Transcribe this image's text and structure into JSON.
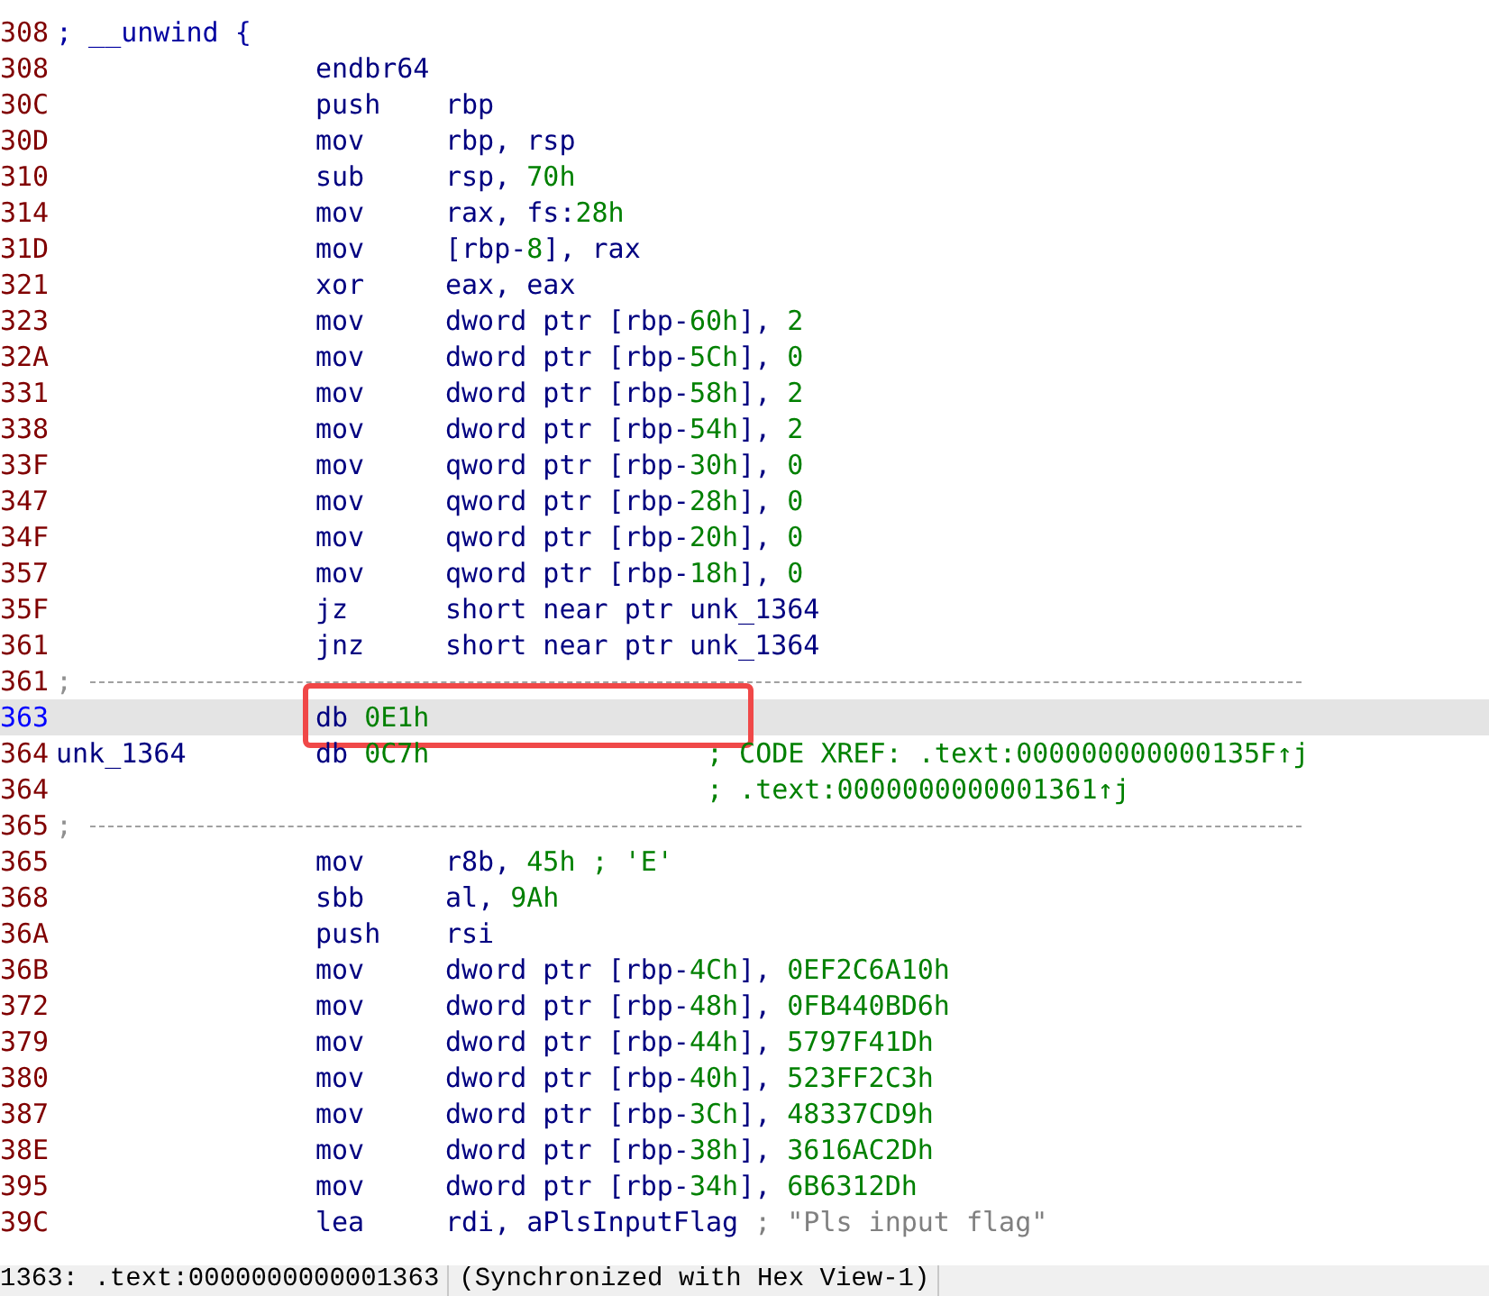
{
  "listing": [
    {
      "kind": "code",
      "addr": {
        "text": "308",
        "kind": "code"
      },
      "label": {
        "text": "; __unwind {",
        "kind": "comment"
      }
    },
    {
      "kind": "code",
      "addr": {
        "text": "308",
        "kind": "code"
      },
      "mnemonic": "endbr64"
    },
    {
      "kind": "code",
      "addr": {
        "text": "30C",
        "kind": "code"
      },
      "mnemonic": "push",
      "operands": [
        {
          "text": "rbp",
          "kind": "plain"
        }
      ]
    },
    {
      "kind": "code",
      "addr": {
        "text": "30D",
        "kind": "code"
      },
      "mnemonic": "mov",
      "operands": [
        {
          "text": "rbp, rsp",
          "kind": "plain"
        }
      ]
    },
    {
      "kind": "code",
      "addr": {
        "text": "310",
        "kind": "code"
      },
      "mnemonic": "sub",
      "operands": [
        {
          "text": "rsp, ",
          "kind": "plain"
        },
        {
          "text": "70h",
          "kind": "num"
        }
      ]
    },
    {
      "kind": "code",
      "addr": {
        "text": "314",
        "kind": "code"
      },
      "mnemonic": "mov",
      "operands": [
        {
          "text": "rax, fs:",
          "kind": "plain"
        },
        {
          "text": "28h",
          "kind": "num"
        }
      ]
    },
    {
      "kind": "code",
      "addr": {
        "text": "31D",
        "kind": "code"
      },
      "mnemonic": "mov",
      "operands": [
        {
          "text": "[rbp-",
          "kind": "plain"
        },
        {
          "text": "8",
          "kind": "num"
        },
        {
          "text": "], rax",
          "kind": "plain"
        }
      ]
    },
    {
      "kind": "code",
      "addr": {
        "text": "321",
        "kind": "code"
      },
      "mnemonic": "xor",
      "operands": [
        {
          "text": "eax, eax",
          "kind": "plain"
        }
      ]
    },
    {
      "kind": "code",
      "addr": {
        "text": "323",
        "kind": "code"
      },
      "mnemonic": "mov",
      "operands": [
        {
          "text": "dword ptr [rbp-",
          "kind": "plain"
        },
        {
          "text": "60h",
          "kind": "num"
        },
        {
          "text": "], ",
          "kind": "plain"
        },
        {
          "text": "2",
          "kind": "num"
        }
      ]
    },
    {
      "kind": "code",
      "addr": {
        "text": "32A",
        "kind": "code"
      },
      "mnemonic": "mov",
      "operands": [
        {
          "text": "dword ptr [rbp-",
          "kind": "plain"
        },
        {
          "text": "5Ch",
          "kind": "num"
        },
        {
          "text": "], ",
          "kind": "plain"
        },
        {
          "text": "0",
          "kind": "num"
        }
      ]
    },
    {
      "kind": "code",
      "addr": {
        "text": "331",
        "kind": "code"
      },
      "mnemonic": "mov",
      "operands": [
        {
          "text": "dword ptr [rbp-",
          "kind": "plain"
        },
        {
          "text": "58h",
          "kind": "num"
        },
        {
          "text": "], ",
          "kind": "plain"
        },
        {
          "text": "2",
          "kind": "num"
        }
      ]
    },
    {
      "kind": "code",
      "addr": {
        "text": "338",
        "kind": "code"
      },
      "mnemonic": "mov",
      "operands": [
        {
          "text": "dword ptr [rbp-",
          "kind": "plain"
        },
        {
          "text": "54h",
          "kind": "num"
        },
        {
          "text": "], ",
          "kind": "plain"
        },
        {
          "text": "2",
          "kind": "num"
        }
      ]
    },
    {
      "kind": "code",
      "addr": {
        "text": "33F",
        "kind": "code"
      },
      "mnemonic": "mov",
      "operands": [
        {
          "text": "qword ptr [rbp-",
          "kind": "plain"
        },
        {
          "text": "30h",
          "kind": "num"
        },
        {
          "text": "], ",
          "kind": "plain"
        },
        {
          "text": "0",
          "kind": "num"
        }
      ]
    },
    {
      "kind": "code",
      "addr": {
        "text": "347",
        "kind": "code"
      },
      "mnemonic": "mov",
      "operands": [
        {
          "text": "qword ptr [rbp-",
          "kind": "plain"
        },
        {
          "text": "28h",
          "kind": "num"
        },
        {
          "text": "], ",
          "kind": "plain"
        },
        {
          "text": "0",
          "kind": "num"
        }
      ]
    },
    {
      "kind": "code",
      "addr": {
        "text": "34F",
        "kind": "code"
      },
      "mnemonic": "mov",
      "operands": [
        {
          "text": "qword ptr [rbp-",
          "kind": "plain"
        },
        {
          "text": "20h",
          "kind": "num"
        },
        {
          "text": "], ",
          "kind": "plain"
        },
        {
          "text": "0",
          "kind": "num"
        }
      ]
    },
    {
      "kind": "code",
      "addr": {
        "text": "357",
        "kind": "code"
      },
      "mnemonic": "mov",
      "operands": [
        {
          "text": "qword ptr [rbp-",
          "kind": "plain"
        },
        {
          "text": "18h",
          "kind": "num"
        },
        {
          "text": "], ",
          "kind": "plain"
        },
        {
          "text": "0",
          "kind": "num"
        }
      ]
    },
    {
      "kind": "code",
      "addr": {
        "text": "35F",
        "kind": "code"
      },
      "mnemonic": "jz",
      "operands": [
        {
          "text": "short near ptr unk_1364",
          "kind": "plain"
        }
      ]
    },
    {
      "kind": "code",
      "addr": {
        "text": "361",
        "kind": "code"
      },
      "mnemonic": "jnz",
      "operands": [
        {
          "text": "short near ptr unk_1364",
          "kind": "plain"
        }
      ]
    },
    {
      "kind": "separator",
      "addr": {
        "text": "361",
        "kind": "code"
      },
      "label": {
        "text": ";",
        "kind": "separator"
      }
    },
    {
      "kind": "data",
      "addr": {
        "text": "363",
        "kind": "cursor"
      },
      "selected": true,
      "annotated": true,
      "mnemonic": "db",
      "operands": [
        {
          "text": "0E1h",
          "kind": "num"
        }
      ]
    },
    {
      "kind": "data",
      "addr": {
        "text": "364",
        "kind": "xref"
      },
      "label": {
        "text": "unk_1364",
        "kind": "name"
      },
      "mnemonic": "db",
      "operands": [
        {
          "text": "0C7h",
          "kind": "num"
        }
      ],
      "comment": "; CODE XREF: .text:000000000000135F↑j"
    },
    {
      "kind": "code",
      "addr": {
        "text": "364",
        "kind": "xref"
      },
      "comment": "; .text:0000000000001361↑j"
    },
    {
      "kind": "separator",
      "addr": {
        "text": "365",
        "kind": "code"
      },
      "label": {
        "text": ";",
        "kind": "separator"
      }
    },
    {
      "kind": "code",
      "addr": {
        "text": "365",
        "kind": "code"
      },
      "mnemonic": "mov",
      "operands": [
        {
          "text": "r8b, ",
          "kind": "plain"
        },
        {
          "text": "45h",
          "kind": "num"
        },
        {
          "text": " ; 'E'",
          "kind": "comment"
        }
      ]
    },
    {
      "kind": "code",
      "addr": {
        "text": "368",
        "kind": "code"
      },
      "mnemonic": "sbb",
      "operands": [
        {
          "text": "al, ",
          "kind": "plain"
        },
        {
          "text": "9Ah",
          "kind": "num"
        }
      ]
    },
    {
      "kind": "code",
      "addr": {
        "text": "36A",
        "kind": "code"
      },
      "mnemonic": "push",
      "operands": [
        {
          "text": "rsi",
          "kind": "plain"
        }
      ]
    },
    {
      "kind": "code",
      "addr": {
        "text": "36B",
        "kind": "code"
      },
      "mnemonic": "mov",
      "operands": [
        {
          "text": "dword ptr [rbp-",
          "kind": "plain"
        },
        {
          "text": "4Ch",
          "kind": "num"
        },
        {
          "text": "], ",
          "kind": "plain"
        },
        {
          "text": "0EF2C6A10h",
          "kind": "num"
        }
      ]
    },
    {
      "kind": "code",
      "addr": {
        "text": "372",
        "kind": "code"
      },
      "mnemonic": "mov",
      "operands": [
        {
          "text": "dword ptr [rbp-",
          "kind": "plain"
        },
        {
          "text": "48h",
          "kind": "num"
        },
        {
          "text": "], ",
          "kind": "plain"
        },
        {
          "text": "0FB440BD6h",
          "kind": "num"
        }
      ]
    },
    {
      "kind": "code",
      "addr": {
        "text": "379",
        "kind": "code"
      },
      "mnemonic": "mov",
      "operands": [
        {
          "text": "dword ptr [rbp-",
          "kind": "plain"
        },
        {
          "text": "44h",
          "kind": "num"
        },
        {
          "text": "], ",
          "kind": "plain"
        },
        {
          "text": "5797F41Dh",
          "kind": "num"
        }
      ]
    },
    {
      "kind": "code",
      "addr": {
        "text": "380",
        "kind": "code"
      },
      "mnemonic": "mov",
      "operands": [
        {
          "text": "dword ptr [rbp-",
          "kind": "plain"
        },
        {
          "text": "40h",
          "kind": "num"
        },
        {
          "text": "], ",
          "kind": "plain"
        },
        {
          "text": "523FF2C3h",
          "kind": "num"
        }
      ]
    },
    {
      "kind": "code",
      "addr": {
        "text": "387",
        "kind": "code"
      },
      "mnemonic": "mov",
      "operands": [
        {
          "text": "dword ptr [rbp-",
          "kind": "plain"
        },
        {
          "text": "3Ch",
          "kind": "num"
        },
        {
          "text": "], ",
          "kind": "plain"
        },
        {
          "text": "48337CD9h",
          "kind": "num"
        }
      ]
    },
    {
      "kind": "code",
      "addr": {
        "text": "38E",
        "kind": "code"
      },
      "mnemonic": "mov",
      "operands": [
        {
          "text": "dword ptr [rbp-",
          "kind": "plain"
        },
        {
          "text": "38h",
          "kind": "num"
        },
        {
          "text": "], ",
          "kind": "plain"
        },
        {
          "text": "3616AC2Dh",
          "kind": "num"
        }
      ]
    },
    {
      "kind": "code",
      "addr": {
        "text": "395",
        "kind": "code"
      },
      "mnemonic": "mov",
      "operands": [
        {
          "text": "dword ptr [rbp-",
          "kind": "plain"
        },
        {
          "text": "34h",
          "kind": "num"
        },
        {
          "text": "], ",
          "kind": "plain"
        },
        {
          "text": "6B6312Dh",
          "kind": "num"
        }
      ]
    },
    {
      "kind": "code",
      "addr": {
        "text": "39C",
        "kind": "code"
      },
      "mnemonic": "lea",
      "operands": [
        {
          "text": "rdi, aPlsInputFlag",
          "kind": "plain"
        },
        {
          "text": " ; \"Pls input flag\"",
          "kind": "string"
        }
      ]
    }
  ],
  "status_bar": {
    "location": "1363: .text:0000000000001363",
    "sync": "(Synchronized with Hex View-1)"
  }
}
